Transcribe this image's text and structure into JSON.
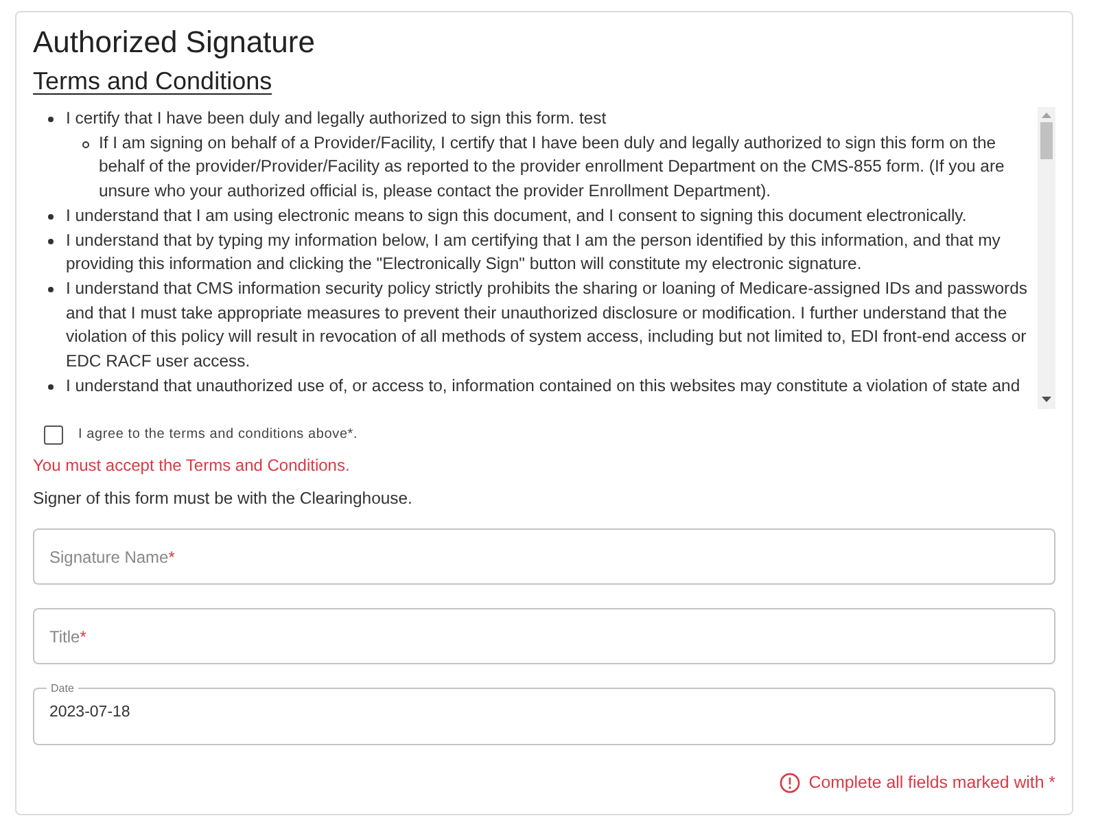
{
  "header": {
    "title": "Authorized Signature",
    "subtitle": "Terms and Conditions"
  },
  "terms": [
    {
      "text": "I certify that I have been duly and legally authorized to sign this form. test",
      "children": [
        {
          "text": "If I am signing on behalf of a Provider/Facility, I certify that I have been duly and legally authorized to sign this form on the behalf of the provider/Provider/Facility as reported to the provider enrollment Department on the CMS-855 form. (If you are unsure who your authorized official is, please contact the provider Enrollment Department)."
        }
      ]
    },
    {
      "text": "I understand that I am using electronic means to sign this document, and I consent to signing this document electronically."
    },
    {
      "text": "I understand that by typing my information below, I am certifying that I am the person identified by this information, and that my providing this information and clicking the \"Electronically Sign\" button will constitute my electronic signature."
    },
    {
      "text": "I understand that CMS information security policy strictly prohibits the sharing or loaning of Medicare-assigned IDs and passwords and that I must take appropriate measures to prevent their unauthorized disclosure or modification. I further understand that the violation of this policy will result in revocation of all methods of system access, including but not limited to, EDI front-end access or EDC RACF user access."
    },
    {
      "text": "I understand that unauthorized use of, or access to, information contained on this websites may constitute a violation of state and"
    }
  ],
  "agreement": {
    "label": "I agree to the terms and conditions above*.",
    "checked": false
  },
  "error": "You must accept the Terms and Conditions.",
  "note": "Signer of this form must be with the Clearinghouse.",
  "fields": [
    {
      "kind": "text",
      "placeholder": "Signature Name",
      "required_mark": "*"
    },
    {
      "kind": "text",
      "placeholder": "Title",
      "required_mark": "*"
    },
    {
      "kind": "date",
      "label": "Date",
      "value": "2023-07-18"
    }
  ],
  "footer": {
    "message": "Complete all fields marked with *"
  }
}
